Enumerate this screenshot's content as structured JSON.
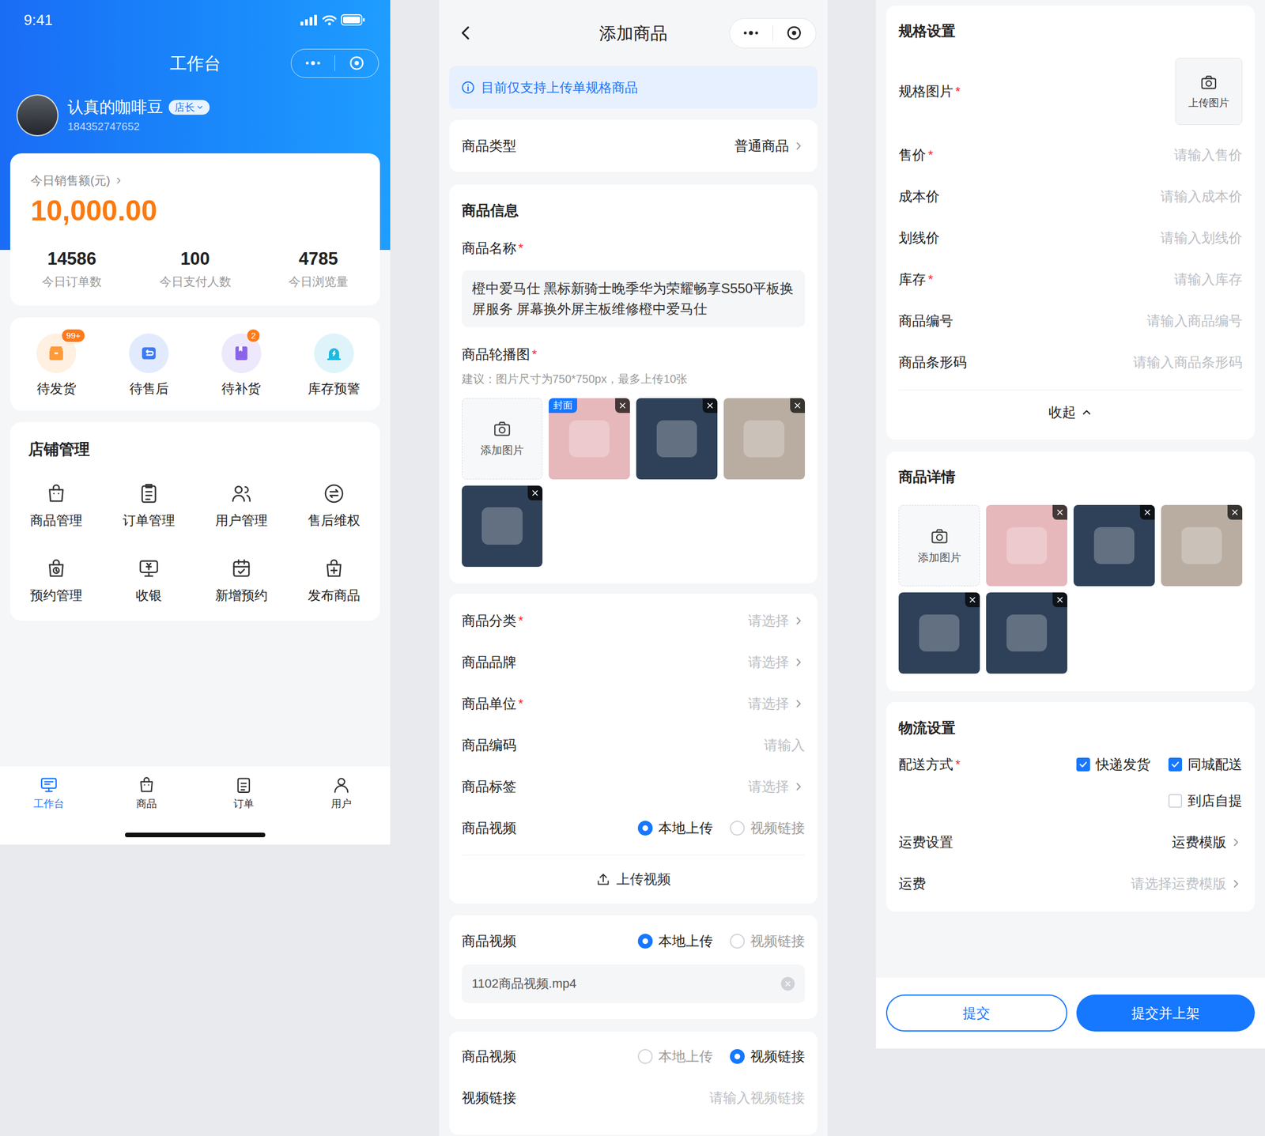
{
  "workbench": {
    "status_time": "9:41",
    "title": "工作台",
    "user": {
      "name": "认真的咖啡豆",
      "role": "店长",
      "phone": "184352747652"
    },
    "sales": {
      "label": "今日销售额(元)",
      "amount": "10,000.00",
      "stats": [
        {
          "value": "14586",
          "label": "今日订单数"
        },
        {
          "value": "100",
          "label": "今日支付人数"
        },
        {
          "value": "4785",
          "label": "今日浏览量"
        }
      ]
    },
    "shortcuts": [
      {
        "label": "待发货",
        "badge": "99+",
        "color": "#ff9a3c"
      },
      {
        "label": "待售后",
        "color": "#3d7bf5"
      },
      {
        "label": "待补货",
        "badge": "2",
        "color": "#8a63e8"
      },
      {
        "label": "库存预警",
        "color": "#1fb8e0"
      }
    ],
    "shop": {
      "title": "店铺管理",
      "items": [
        "商品管理",
        "订单管理",
        "用户管理",
        "售后维权",
        "预约管理",
        "收银",
        "新增预约",
        "发布商品"
      ]
    },
    "tabbar": [
      {
        "label": "工作台",
        "selected": true
      },
      {
        "label": "商品",
        "selected": false
      },
      {
        "label": "订单",
        "selected": false
      },
      {
        "label": "用户",
        "selected": false
      }
    ]
  },
  "add_product": {
    "title": "添加商品",
    "notice": "目前仅支持上传单规格商品",
    "type": {
      "label": "商品类型",
      "value": "普通商品"
    },
    "info": {
      "title": "商品信息",
      "name_label": "商品名称",
      "name_star": "*",
      "name_value": "橙中爱马仕 黑标新骑士晚季华为荣耀畅享S550平板换屏服务 屏幕换外屏主板维修橙中爱马仕",
      "carousel_label": "商品轮播图",
      "carousel_star": "*",
      "carousel_hint": "建议：图片尺寸为750*750px，最多上传10张",
      "add_image": "添加图片",
      "cover_label": "封面",
      "images": [
        {
          "color": "#e6b8bc",
          "cover": true
        },
        {
          "color": "#2f4158",
          "cover": false
        },
        {
          "color": "#b9ada2",
          "cover": false
        },
        {
          "color": "#2f4158",
          "cover": false
        }
      ]
    },
    "attributes": [
      {
        "label": "商品分类",
        "star": "*",
        "kind": "select",
        "text": "请选择"
      },
      {
        "label": "商品品牌",
        "kind": "select",
        "text": "请选择"
      },
      {
        "label": "商品单位",
        "star": "*",
        "kind": "select",
        "text": "请选择"
      },
      {
        "label": "商品编码",
        "kind": "input",
        "placeholder": "请输入"
      },
      {
        "label": "商品标签",
        "kind": "select",
        "text": "请选择"
      }
    ],
    "video_upload": {
      "label": "商品视频",
      "options": [
        {
          "label": "本地上传",
          "selected": true
        },
        {
          "label": "视频链接",
          "selected": false
        }
      ],
      "button": "上传视频"
    },
    "video_file": {
      "label": "商品视频",
      "options": [
        {
          "label": "本地上传",
          "selected": true
        },
        {
          "label": "视频链接",
          "selected": false
        }
      ],
      "file": "1102商品视频.mp4"
    },
    "video_link": {
      "label": "商品视频",
      "options": [
        {
          "label": "本地上传",
          "selected": false
        },
        {
          "label": "视频链接",
          "selected": true
        }
      ],
      "link_label": "视频链接",
      "placeholder": "请输入视频链接"
    }
  },
  "spec_page": {
    "spec": {
      "title": "规格设置",
      "image_label": "规格图片",
      "image_star": "*",
      "upload": "上传图片",
      "fields": [
        {
          "label": "售价",
          "star": "*",
          "kind": "input",
          "placeholder": "请输入售价"
        },
        {
          "label": "成本价",
          "kind": "input",
          "placeholder": "请输入成本价"
        },
        {
          "label": "划线价",
          "kind": "input",
          "placeholder": "请输入划线价"
        },
        {
          "label": "库存",
          "star": "*",
          "kind": "input",
          "placeholder": "请输入库存"
        },
        {
          "label": "商品编号",
          "kind": "input",
          "placeholder": "请输入商品编号"
        },
        {
          "label": "商品条形码",
          "kind": "input",
          "placeholder": "请输入商品条形码"
        }
      ],
      "collapse": "收起"
    },
    "detail": {
      "title": "商品详情",
      "add_image": "添加图片",
      "images": [
        {
          "color": "#e6b8bc"
        },
        {
          "color": "#2f4158"
        },
        {
          "color": "#b9ada2"
        },
        {
          "color": "#2f4158"
        },
        {
          "color": "#2f4158"
        }
      ]
    },
    "logistics": {
      "title": "物流设置",
      "delivery_label": "配送方式",
      "delivery_star": "*",
      "options": [
        {
          "label": "快递发货",
          "checked": true
        },
        {
          "label": "同城配送",
          "checked": true
        },
        {
          "label": "到店自提",
          "checked": false
        }
      ],
      "rows": [
        {
          "label": "运费设置",
          "text": "运费模版",
          "placeholder": false
        },
        {
          "label": "运费",
          "text": "请选择运费模版",
          "placeholder": true
        }
      ]
    },
    "buttons": [
      {
        "label": "提交",
        "kind": "outline"
      },
      {
        "label": "提交并上架",
        "kind": "filled"
      }
    ]
  }
}
